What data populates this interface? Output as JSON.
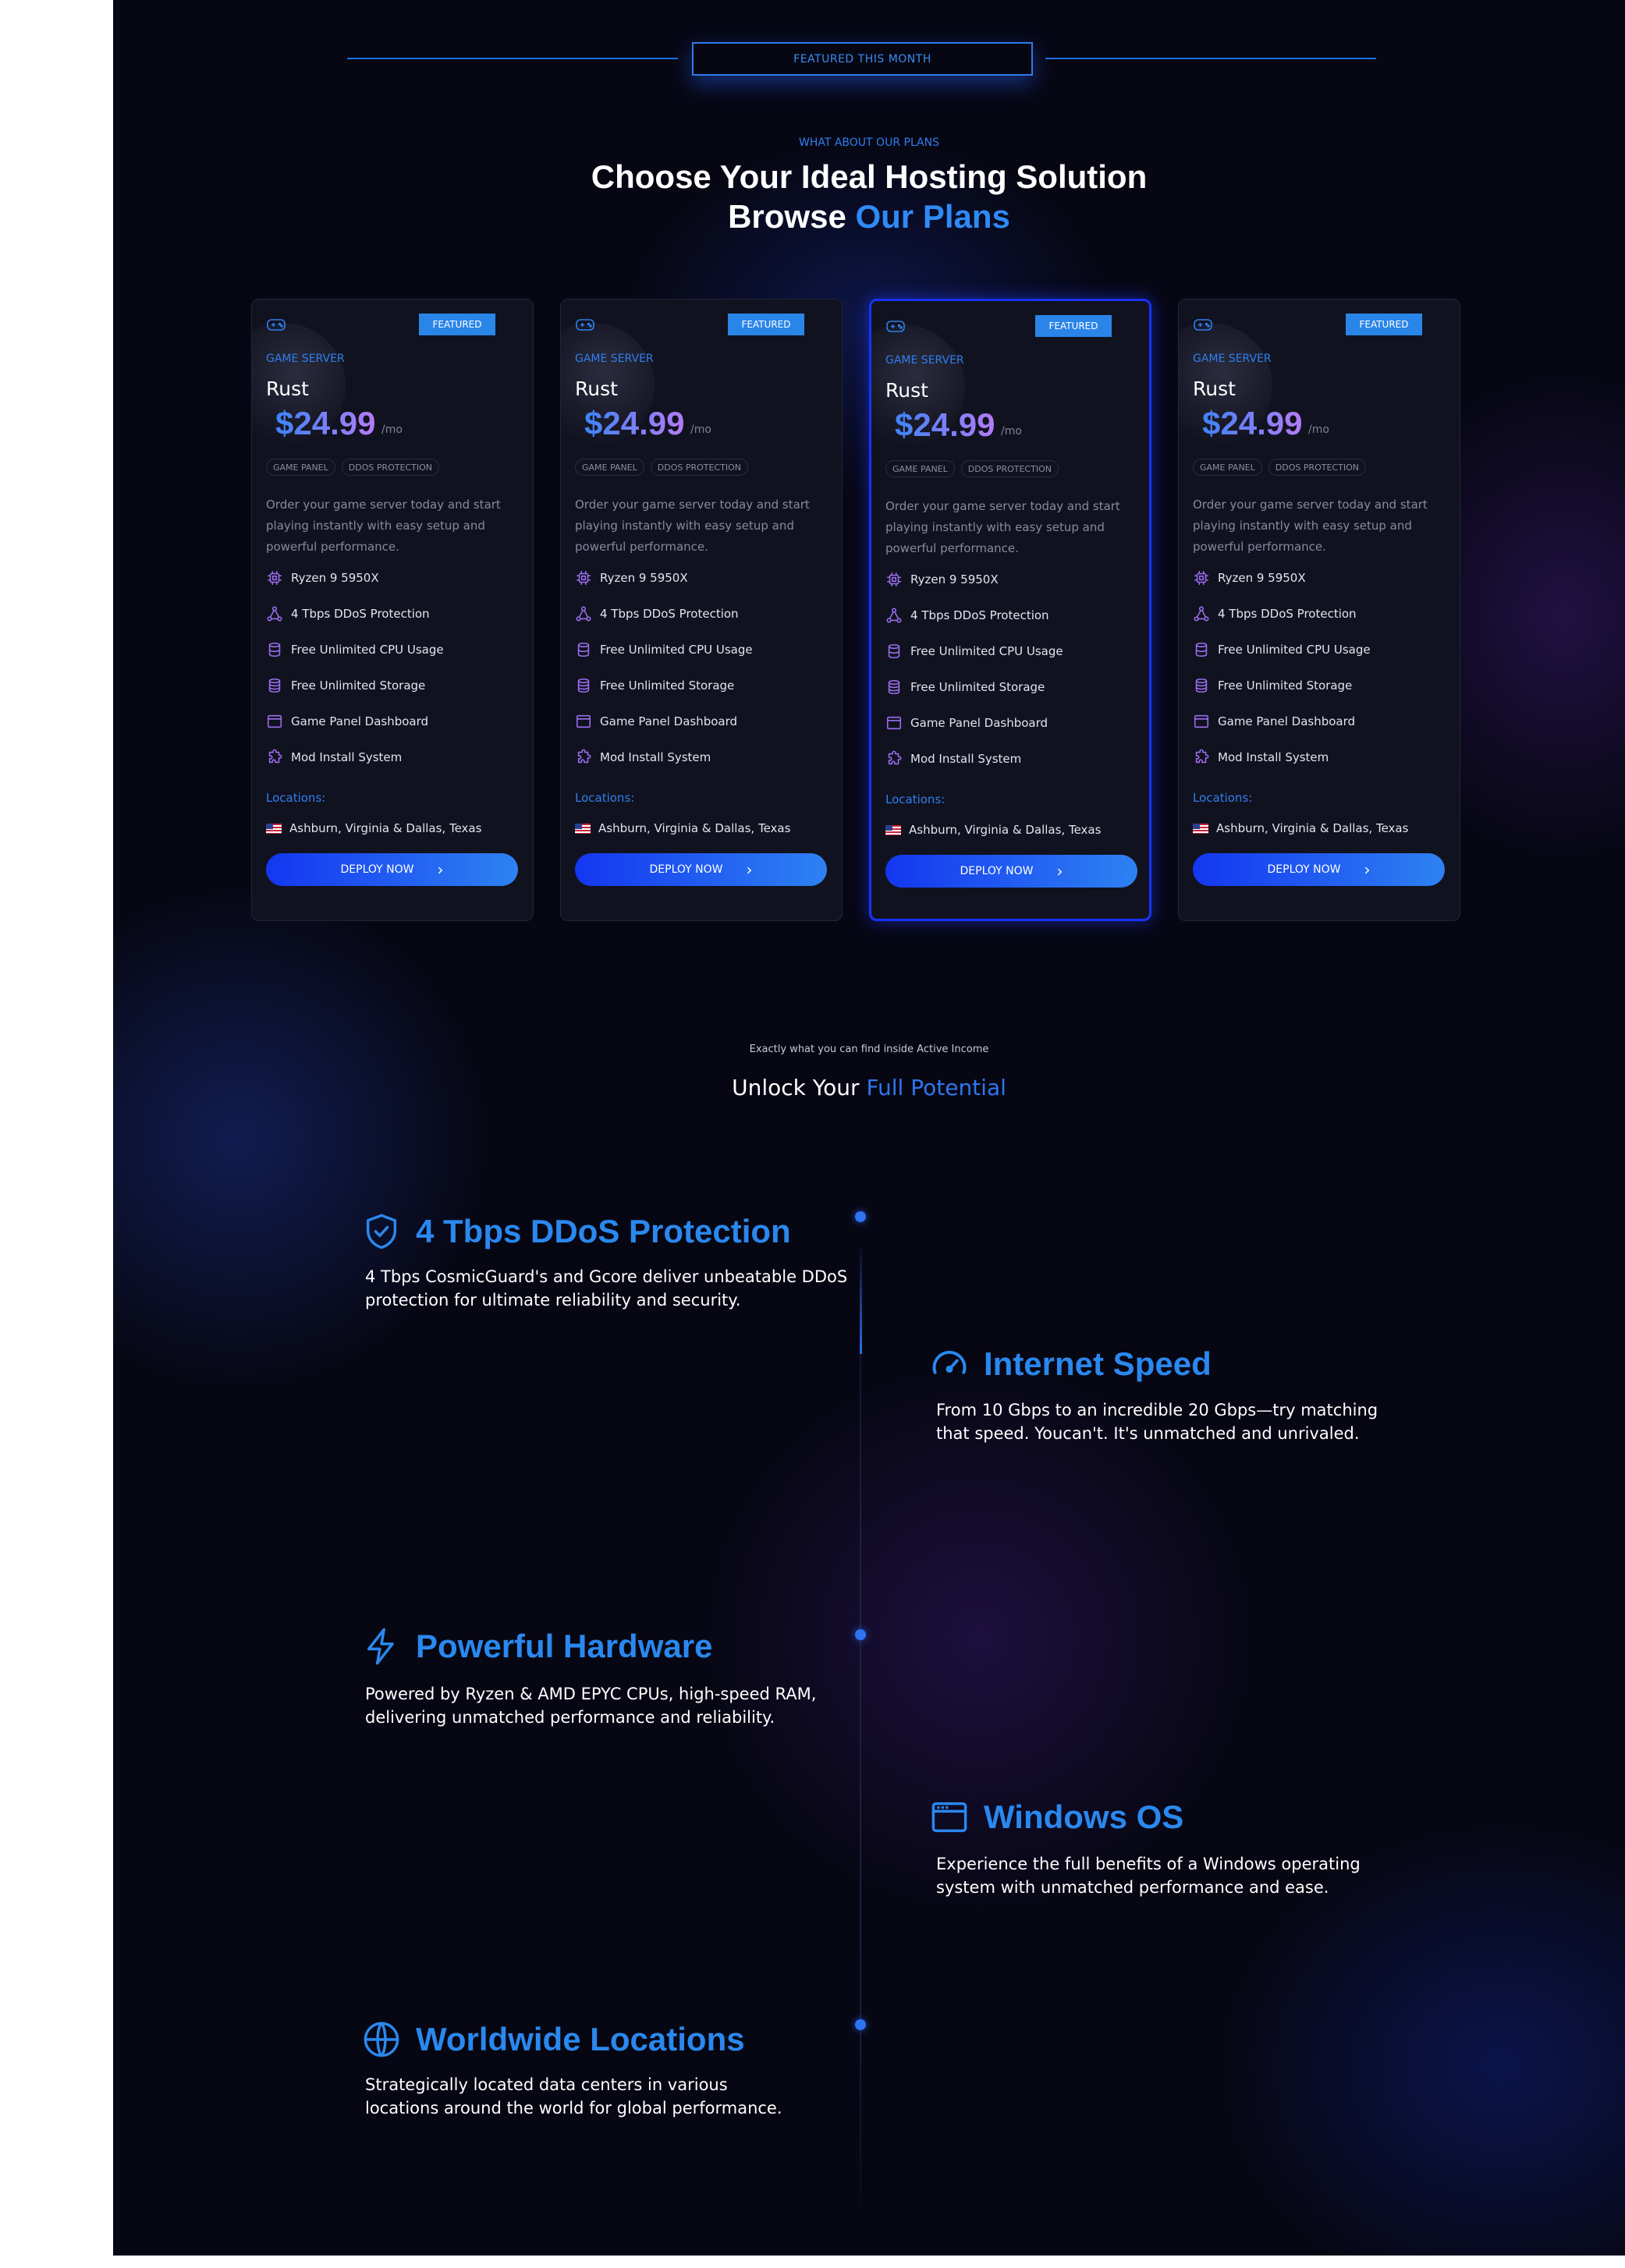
{
  "featured_banner": "FEATURED THIS MONTH",
  "plans_section": {
    "eyebrow": "WHAT ABOUT OUR PLANS",
    "headline_line1": "Choose Your Ideal Hosting Solution",
    "headline_line2_prefix": "Browse ",
    "headline_line2_accent": "Our Plans"
  },
  "cards": [
    {
      "badge": "FEATURED",
      "category": "GAME SERVER",
      "game": "Rust",
      "price": "$24.99",
      "per": "/mo",
      "tags": [
        "GAME PANEL",
        "DDOS PROTECTION"
      ],
      "description": "Order your game server today and start playing instantly with easy setup and powerful performance.",
      "features": [
        "Ryzen 9 5950X",
        "4 Tbps DDoS Protection",
        "Free Unlimited CPU Usage",
        "Free Unlimited Storage",
        "Game Panel Dashboard",
        "Mod Install System"
      ],
      "locations_label": "Locations:",
      "location": "Ashburn, Virginia & Dallas, Texas",
      "button": "DEPLOY NOW",
      "highlighted": false
    },
    {
      "badge": "FEATURED",
      "category": "GAME SERVER",
      "game": "Rust",
      "price": "$24.99",
      "per": "/mo",
      "tags": [
        "GAME PANEL",
        "DDOS PROTECTION"
      ],
      "description": "Order your game server today and start playing instantly with easy setup and powerful performance.",
      "features": [
        "Ryzen 9 5950X",
        "4 Tbps DDoS Protection",
        "Free Unlimited CPU Usage",
        "Free Unlimited Storage",
        "Game Panel Dashboard",
        "Mod Install System"
      ],
      "locations_label": "Locations:",
      "location": "Ashburn, Virginia & Dallas, Texas",
      "button": "DEPLOY NOW",
      "highlighted": false
    },
    {
      "badge": "FEATURED",
      "category": "GAME SERVER",
      "game": "Rust",
      "price": "$24.99",
      "per": "/mo",
      "tags": [
        "GAME PANEL",
        "DDOS PROTECTION"
      ],
      "description": "Order your game server today and start playing instantly with easy setup and powerful performance.",
      "features": [
        "Ryzen 9 5950X",
        "4 Tbps DDoS Protection",
        "Free Unlimited CPU Usage",
        "Free Unlimited Storage",
        "Game Panel Dashboard",
        "Mod Install System"
      ],
      "locations_label": "Locations:",
      "location": "Ashburn, Virginia & Dallas, Texas",
      "button": "DEPLOY NOW",
      "highlighted": true
    },
    {
      "badge": "FEATURED",
      "category": "GAME SERVER",
      "game": "Rust",
      "price": "$24.99",
      "per": "/mo",
      "tags": [
        "GAME PANEL",
        "DDOS PROTECTION"
      ],
      "description": "Order your game server today and start playing instantly with easy setup and powerful performance.",
      "features": [
        "Ryzen 9 5950X",
        "4 Tbps DDoS Protection",
        "Free Unlimited CPU Usage",
        "Free Unlimited Storage",
        "Game Panel Dashboard",
        "Mod Install System"
      ],
      "locations_label": "Locations:",
      "location": "Ashburn, Virginia & Dallas, Texas",
      "button": "DEPLOY NOW",
      "highlighted": false
    }
  ],
  "feature_icons": [
    "cpu-icon",
    "network-icon",
    "database-icon",
    "storage-icon",
    "browser-window-icon",
    "puzzle-icon"
  ],
  "benefits_section": {
    "eyebrow": "Exactly what you can find inside Active Income",
    "headline_prefix": "Unlock Your ",
    "headline_accent": "Full Potential",
    "items": [
      {
        "icon": "shield-check-icon",
        "title": "4 Tbps DDoS Protection",
        "line1": "4 Tbps CosmicGuard's and Gcore deliver unbeatable DDoS",
        "line2": "protection for ultimate reliability and security."
      },
      {
        "icon": "speedometer-icon",
        "title": "Internet Speed",
        "line1": "From 10 Gbps to an incredible 20 Gbps—try matching",
        "line2": "that speed. Youcan't. It's unmatched and unrivaled."
      },
      {
        "icon": "lightning-icon",
        "title": "Powerful Hardware",
        "line1": "Powered by Ryzen & AMD EPYC CPUs, high-speed RAM,",
        "line2": "delivering unmatched performance and reliability."
      },
      {
        "icon": "browser-window-icon",
        "title": "Windows OS",
        "line1": "Experience the full benefits of a Windows operating",
        "line2": "system with unmatched performance and ease."
      },
      {
        "icon": "globe-icon",
        "title": "Worldwide Locations",
        "line1": "Strategically located data centers in various",
        "line2": "locations around the world for global performance."
      }
    ]
  },
  "colors": {
    "background": "#070714",
    "accent": "#2a88ee",
    "button_start": "#1437f0",
    "button_end": "#2e82f2",
    "icon_purple": "#9b6ef0"
  }
}
